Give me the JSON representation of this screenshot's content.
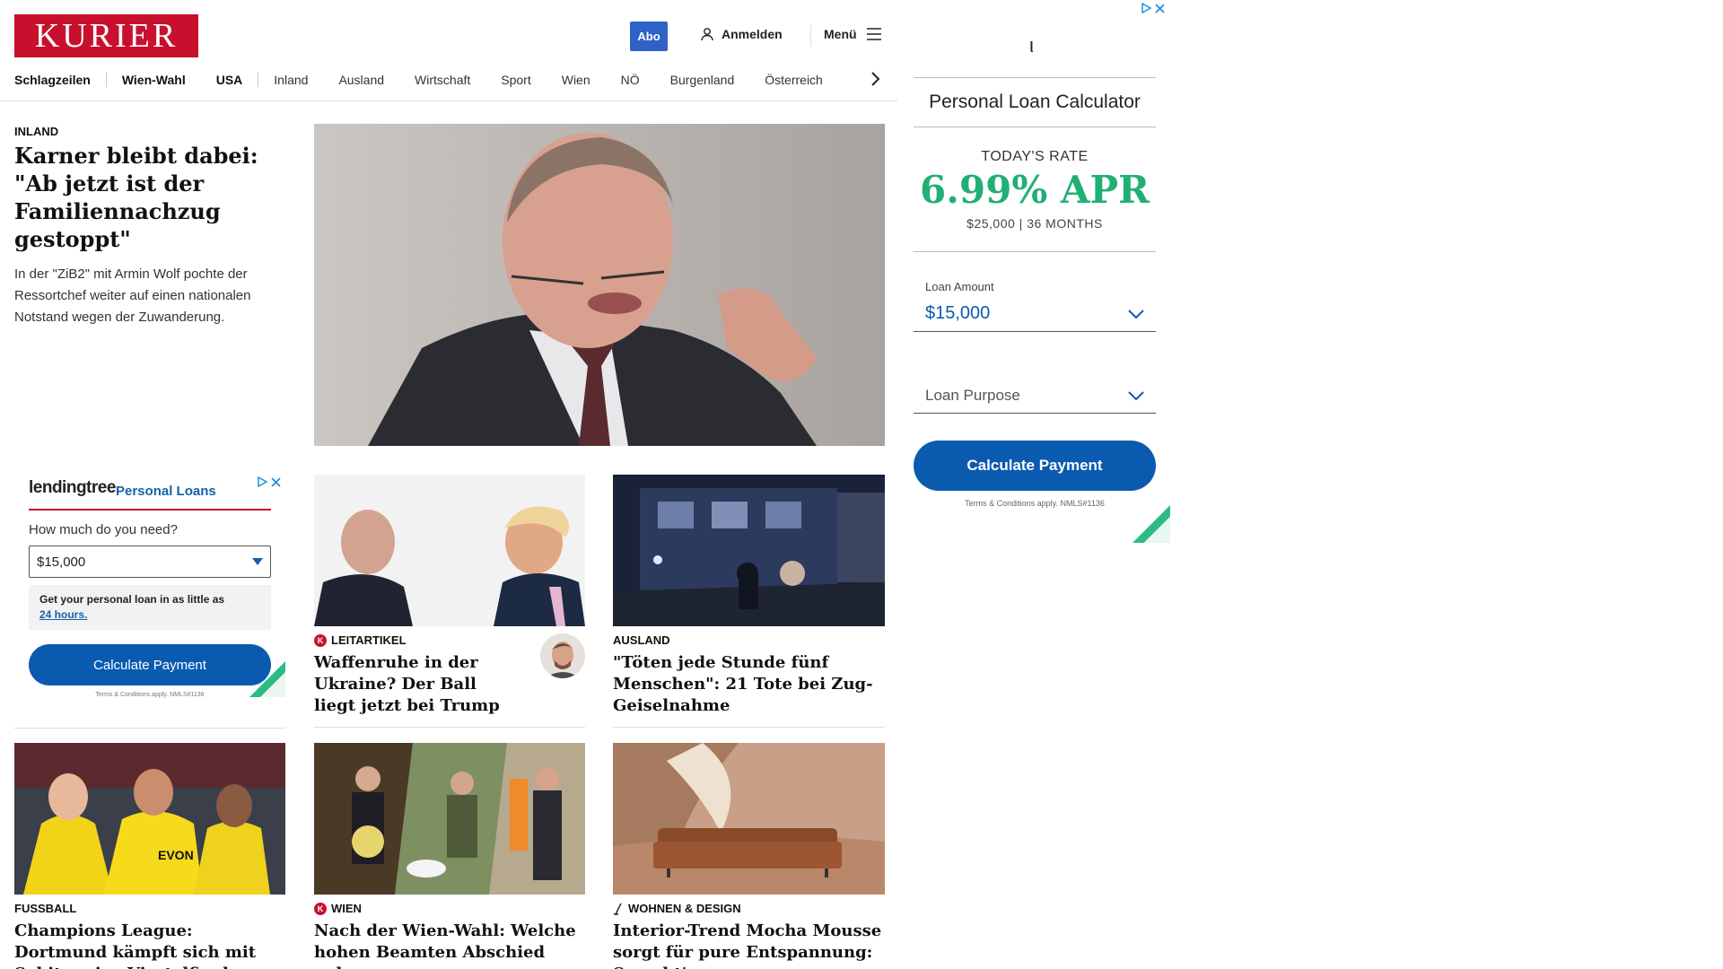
{
  "header": {
    "logo": "KURIER",
    "abo_label": "Abo",
    "login_label": "Anmelden",
    "menu_label": "Menü"
  },
  "nav": {
    "items": [
      {
        "label": "Schlagzeilen"
      },
      {
        "label": "Wien-Wahl"
      },
      {
        "label": "USA"
      },
      {
        "label": "Inland"
      },
      {
        "label": "Ausland"
      },
      {
        "label": "Wirtschaft"
      },
      {
        "label": "Sport"
      },
      {
        "label": "Wien"
      },
      {
        "label": "NÖ"
      },
      {
        "label": "Burgenland"
      },
      {
        "label": "Österreich"
      }
    ]
  },
  "lead": {
    "category": "INLAND",
    "title": "Karner bleibt dabei: \"Ab jetzt ist der Familiennachzug gestoppt\"",
    "teaser": "In der \"ZiB2\" mit Armin Wolf pochte der Ressortchef weiter auf einen nationalen Notstand wegen der Zuwanderung."
  },
  "left_ad": {
    "brand": "lendingtree",
    "product": "Personal Loans",
    "question": "How much do you need?",
    "selected_amount": "$15,000",
    "info_text": "Get your personal loan in as little as",
    "info_link": "24 hours.",
    "button": "Calculate Payment",
    "terms": "Terms & Conditions apply. NMLS#1136"
  },
  "cards": [
    {
      "category": "LEITARTIKEL",
      "title": "Waffenruhe in der Ukraine? Der Ball liegt jetzt bei Trump",
      "badge": "K"
    },
    {
      "category": "AUSLAND",
      "title": "\"Töten jede Stunde fünf Menschen\": 21 Tote bei Zug-Geiselnahme"
    },
    {
      "category": "FUSSBALL",
      "title": "Champions League: Dortmund kämpft sich mit Sabitzer ins Viertelfinale"
    },
    {
      "category": "WIEN",
      "title": "Nach der Wien-Wahl: Welche hohen Beamten Abschied nehmen",
      "badge": "K"
    },
    {
      "category": "WOHNEN & DESIGN",
      "title": "Interior-Trend Mocha Mousse sorgt für pure Entspannung: So geht's"
    }
  ],
  "right_ad": {
    "title": "Personal Loan Calculator",
    "rate_label": "TODAY'S RATE",
    "rate": "6.99% APR",
    "rate_terms": "$25,000 | 36 MONTHS",
    "loan_amount_label": "Loan Amount",
    "loan_amount_value": "$15,000",
    "loan_purpose_placeholder": "Loan Purpose",
    "button": "Calculate Payment",
    "terms": "Terms & Conditions apply. NMLS#1136"
  },
  "colors": {
    "brand_red": "#c8102e",
    "abo_blue": "#2f62c7",
    "ad_blue": "#0a5bb0",
    "rate_green": "#21b074"
  }
}
